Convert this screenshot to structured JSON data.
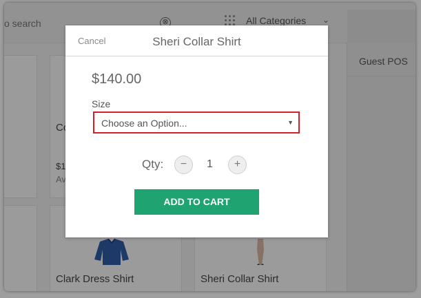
{
  "search": {
    "placeholder_visible": "o search",
    "clear_glyph": "⊗"
  },
  "categories": {
    "selected": "All Categories",
    "chevron": "⌄"
  },
  "sidebar": {
    "guest_label": "Guest POS"
  },
  "products": [
    {
      "name": "Co",
      "price": "$1",
      "availability": "Av"
    },
    {
      "name": "Clark Dress Shirt"
    },
    {
      "name": "Sheri Collar Shirt"
    }
  ],
  "modal": {
    "cancel_label": "Cancel",
    "title": "Sheri Collar Shirt",
    "price": "$140.00",
    "size_label": "Size",
    "size_value": "Choose an Option...",
    "caret": "▼",
    "qty_label": "Qty:",
    "qty_value": "1",
    "minus": "−",
    "plus": "+",
    "add_label": "ADD TO CART"
  },
  "colors": {
    "accent_green": "#1fa471",
    "error_red": "#d21f2a"
  },
  "icons": [
    "clear-search-icon",
    "grid-icon",
    "chevron-down-icon",
    "minus-icon",
    "plus-icon",
    "caret-down-icon"
  ]
}
